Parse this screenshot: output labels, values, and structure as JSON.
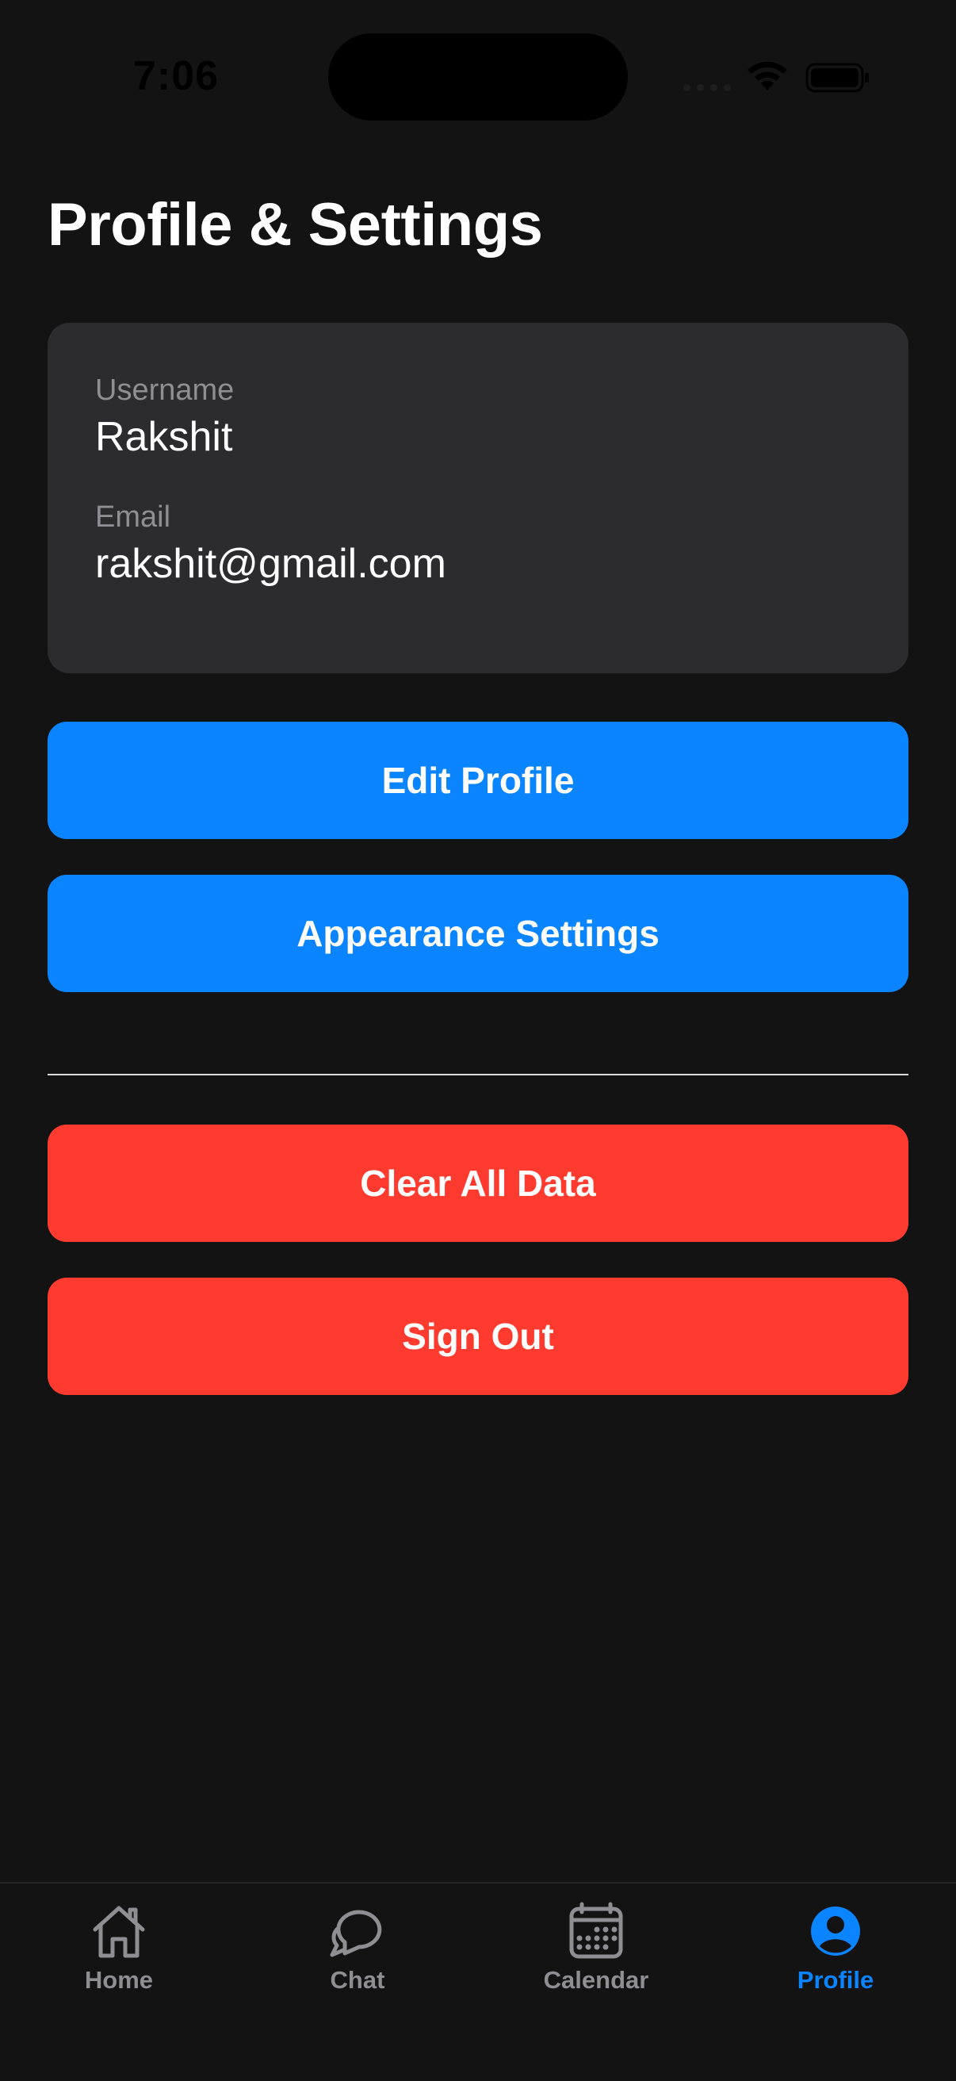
{
  "status_bar": {
    "time": "7:06"
  },
  "page": {
    "title": "Profile & Settings"
  },
  "profile_card": {
    "username_label": "Username",
    "username_value": "Rakshit",
    "email_label": "Email",
    "email_value": "rakshit@gmail.com"
  },
  "actions": {
    "edit_profile_label": "Edit Profile",
    "appearance_settings_label": "Appearance Settings",
    "clear_all_data_label": "Clear All Data",
    "sign_out_label": "Sign Out"
  },
  "tab_bar": {
    "items": [
      {
        "label": "Home",
        "icon": "home-icon",
        "active": false
      },
      {
        "label": "Chat",
        "icon": "chat-bubbles-icon",
        "active": false
      },
      {
        "label": "Calendar",
        "icon": "calendar-icon",
        "active": false
      },
      {
        "label": "Profile",
        "icon": "person-circle-icon",
        "active": true
      }
    ]
  },
  "colors": {
    "background": "#131313",
    "card": "#2c2c2e",
    "accent_blue": "#0a84ff",
    "destructive_red": "#ff3b30",
    "secondary_text": "#8e8e93"
  }
}
